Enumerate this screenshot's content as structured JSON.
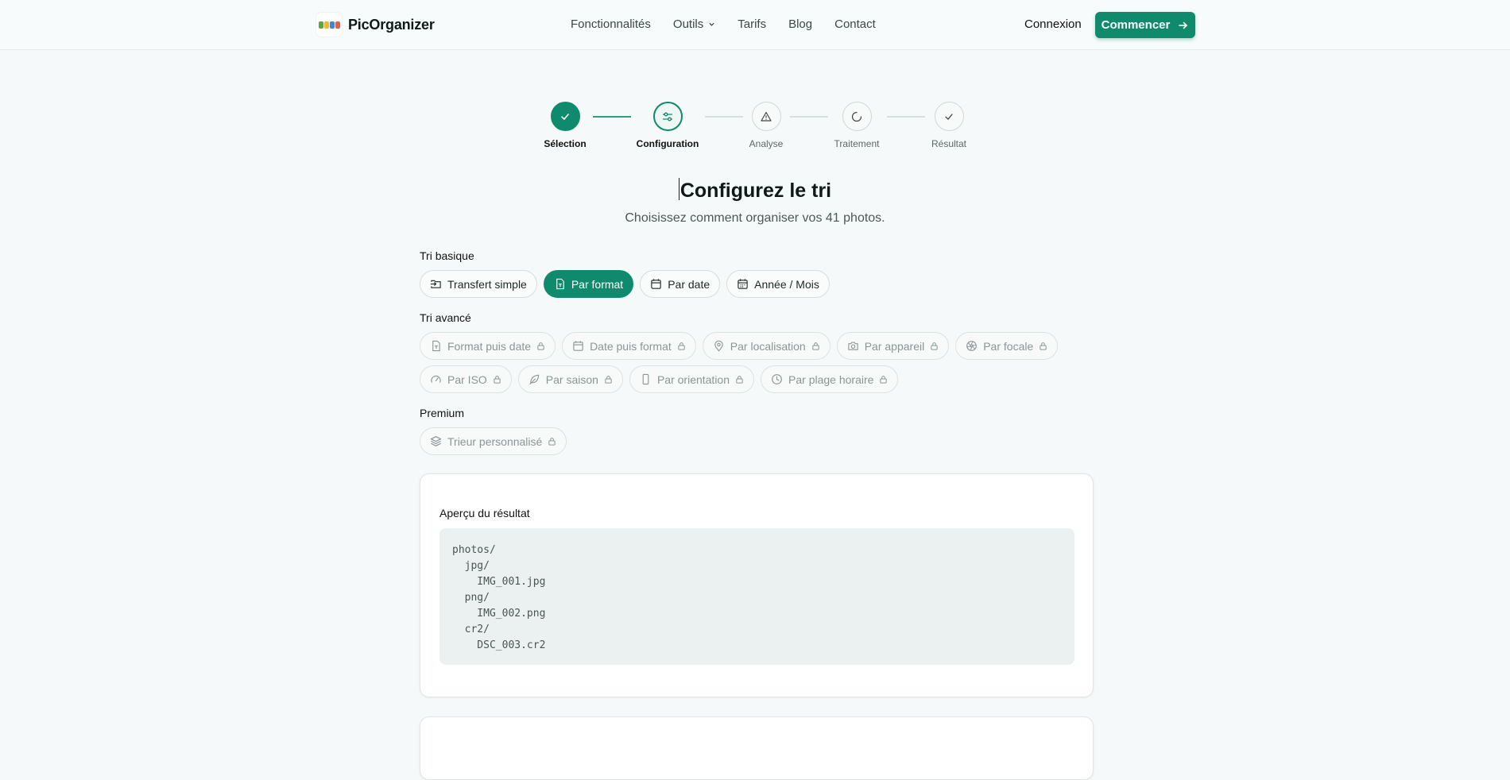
{
  "header": {
    "brand": "PicOrganizer",
    "nav": [
      "Fonctionnalités",
      "Outils",
      "Tarifs",
      "Blog",
      "Contact"
    ],
    "login": "Connexion",
    "cta": "Commencer"
  },
  "stepper": {
    "steps": [
      {
        "label": "Sélection",
        "state": "done"
      },
      {
        "label": "Configuration",
        "state": "active"
      },
      {
        "label": "Analyse",
        "state": "todo"
      },
      {
        "label": "Traitement",
        "state": "todo"
      },
      {
        "label": "Résultat",
        "state": "todo"
      }
    ]
  },
  "page": {
    "title": "Configurez le tri",
    "subtitle": "Choisissez comment organiser vos 41 photos."
  },
  "basic": {
    "label": "Tri basique",
    "options": [
      "Transfert simple",
      "Par format",
      "Par date",
      "Année / Mois"
    ],
    "selected": "Par format"
  },
  "advanced": {
    "label": "Tri avancé",
    "options": [
      "Format puis date",
      "Date puis format",
      "Par localisation",
      "Par appareil",
      "Par focale",
      "Par ISO",
      "Par saison",
      "Par orientation",
      "Par plage horaire"
    ]
  },
  "premium": {
    "label": "Premium",
    "options": [
      "Trieur personnalisé"
    ]
  },
  "preview": {
    "title": "Aperçu du résultat",
    "tree": [
      "photos/",
      "  jpg/",
      "    IMG_001.jpg",
      "  png/",
      "    IMG_002.png",
      "  cr2/",
      "    DSC_003.cr2"
    ]
  },
  "colors": {
    "accent": "#0f8a6c",
    "background": "#f6f9f9"
  }
}
